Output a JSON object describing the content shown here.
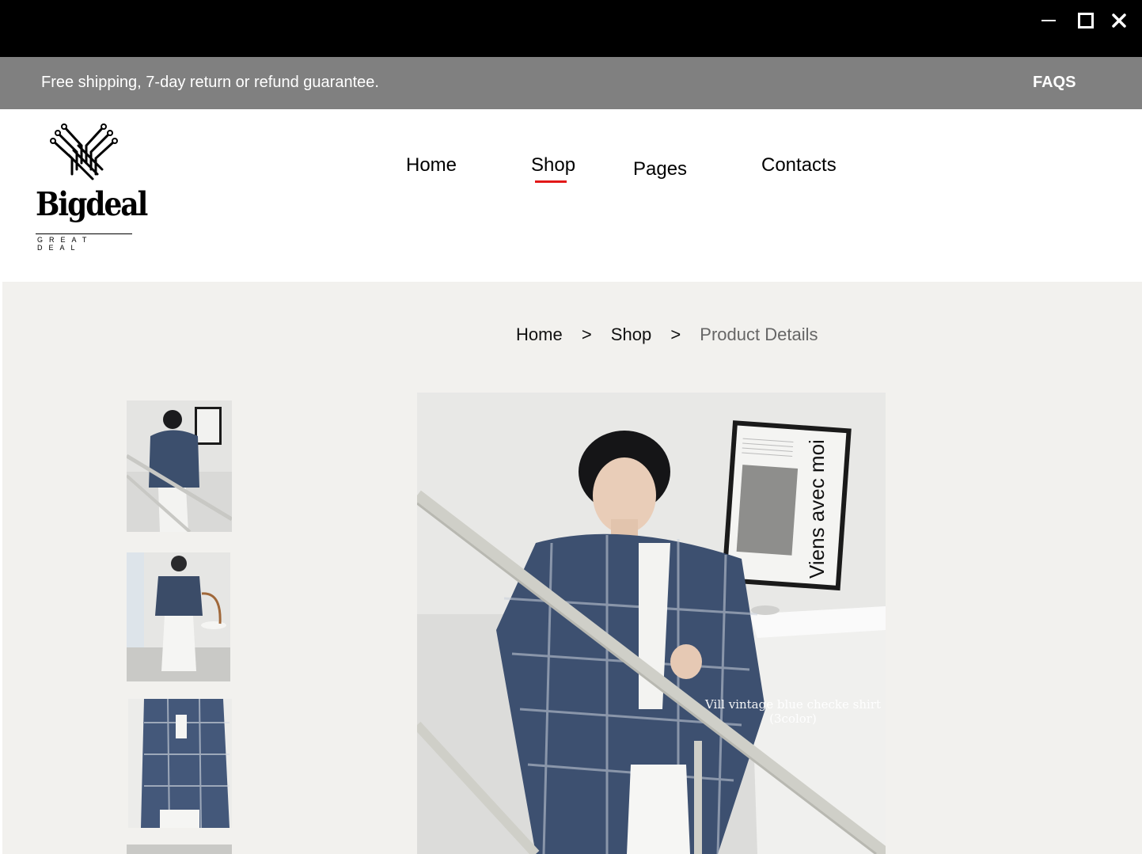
{
  "window": {
    "controls": [
      "minimize-icon",
      "maximize-icon",
      "close-icon"
    ]
  },
  "announcement": {
    "text": "Free shipping, 7-day return or refund guarantee.",
    "faqs": "FAQS"
  },
  "logo": {
    "name": "Bigdeal",
    "tagline": "GREAT DEAL"
  },
  "nav": {
    "items": [
      {
        "label": "Home"
      },
      {
        "label": "Shop",
        "active": true
      },
      {
        "label": "Pages"
      },
      {
        "label": "Contacts"
      }
    ],
    "active_color": "#e21818"
  },
  "breadcrumb": {
    "home": "Home",
    "shop": "Shop",
    "current": "Product Details",
    "separator": ">"
  },
  "product": {
    "image_caption_line1": "Vill vintage blue checke shirt",
    "image_caption_line2": "(3color)",
    "poster_text": "Viens avec moi"
  },
  "colors": {
    "titlebar": "#000000",
    "announcement_bg": "#808080",
    "main_bg": "#f2f1ee"
  }
}
